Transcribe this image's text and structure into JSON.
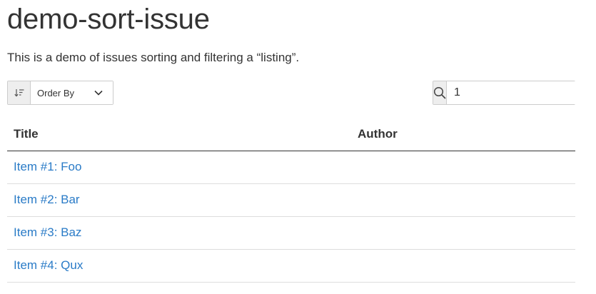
{
  "page": {
    "title": "demo-sort-issue",
    "description": "This is a demo of issues sorting and filtering a “listing”."
  },
  "toolbar": {
    "sort_direction_icon": "sort-descending-icon",
    "order_by_label": "Order By",
    "order_by_icon": "chevron-down-icon",
    "search_icon": "search-icon",
    "search_value": "1"
  },
  "table": {
    "columns": [
      "Title",
      "Author"
    ],
    "rows": [
      {
        "title": "Item #1: Foo",
        "author": ""
      },
      {
        "title": "Item #2: Bar",
        "author": ""
      },
      {
        "title": "Item #3: Baz",
        "author": ""
      },
      {
        "title": "Item #4: Qux",
        "author": ""
      }
    ]
  },
  "colors": {
    "link": "#2a7bc7",
    "text": "#333333",
    "border": "#cccccc",
    "addon_background": "#eeeeee"
  }
}
